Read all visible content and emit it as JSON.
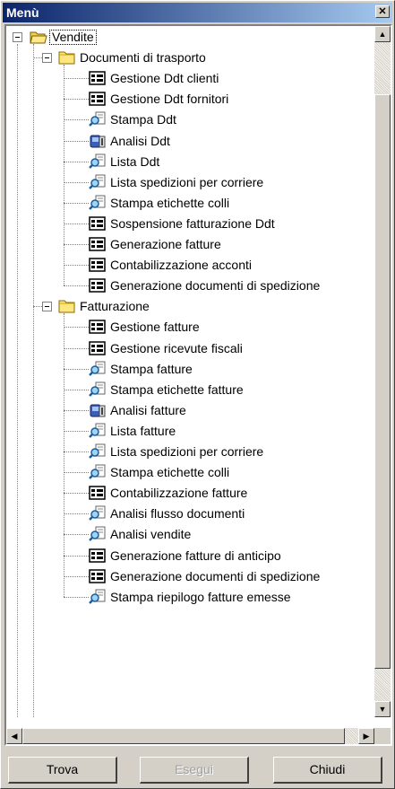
{
  "window": {
    "title": "Menù",
    "close_glyph": "✕"
  },
  "tree": {
    "root": {
      "label": "Vendite",
      "icon": "open-folder-icon"
    },
    "groups": [
      {
        "label": "Documenti di trasporto",
        "icon": "folder-icon",
        "items": [
          {
            "label": "Gestione Ddt clienti",
            "icon": "form-icon"
          },
          {
            "label": "Gestione Ddt fornitori",
            "icon": "form-icon"
          },
          {
            "label": "Stampa Ddt",
            "icon": "report-icon"
          },
          {
            "label": "Analisi Ddt",
            "icon": "analysis-icon"
          },
          {
            "label": "Lista Ddt",
            "icon": "report-icon"
          },
          {
            "label": "Lista spedizioni per corriere",
            "icon": "report-icon"
          },
          {
            "label": "Stampa etichette colli",
            "icon": "report-icon"
          },
          {
            "label": "Sospensione fatturazione Ddt",
            "icon": "form-icon"
          },
          {
            "label": "Generazione fatture",
            "icon": "form-icon"
          },
          {
            "label": "Contabilizzazione acconti",
            "icon": "form-icon"
          },
          {
            "label": "Generazione documenti di spedizione",
            "icon": "form-icon"
          }
        ]
      },
      {
        "label": "Fatturazione",
        "icon": "folder-icon",
        "items": [
          {
            "label": "Gestione fatture",
            "icon": "form-icon"
          },
          {
            "label": "Gestione ricevute fiscali",
            "icon": "form-icon"
          },
          {
            "label": "Stampa fatture",
            "icon": "report-icon"
          },
          {
            "label": "Stampa etichette fatture",
            "icon": "report-icon"
          },
          {
            "label": "Analisi fatture",
            "icon": "analysis-icon"
          },
          {
            "label": "Lista fatture",
            "icon": "report-icon"
          },
          {
            "label": "Lista spedizioni per corriere",
            "icon": "report-icon"
          },
          {
            "label": "Stampa etichette colli",
            "icon": "report-icon"
          },
          {
            "label": "Contabilizzazione fatture",
            "icon": "form-icon"
          },
          {
            "label": "Analisi flusso documenti",
            "icon": "report-icon"
          },
          {
            "label": "Analisi vendite",
            "icon": "report-icon"
          },
          {
            "label": "Generazione fatture di anticipo",
            "icon": "form-icon"
          },
          {
            "label": "Generazione documenti di spedizione",
            "icon": "form-icon"
          },
          {
            "label": "Stampa riepilogo fatture emesse",
            "icon": "report-icon"
          }
        ]
      }
    ]
  },
  "scrollbars": {
    "up": "▲",
    "down": "▼",
    "left": "◀",
    "right": "▶"
  },
  "buttons": {
    "find": {
      "label": "Trova",
      "enabled": true
    },
    "run": {
      "label": "Esegui",
      "enabled": false
    },
    "close": {
      "label": "Chiudi",
      "enabled": true
    }
  }
}
